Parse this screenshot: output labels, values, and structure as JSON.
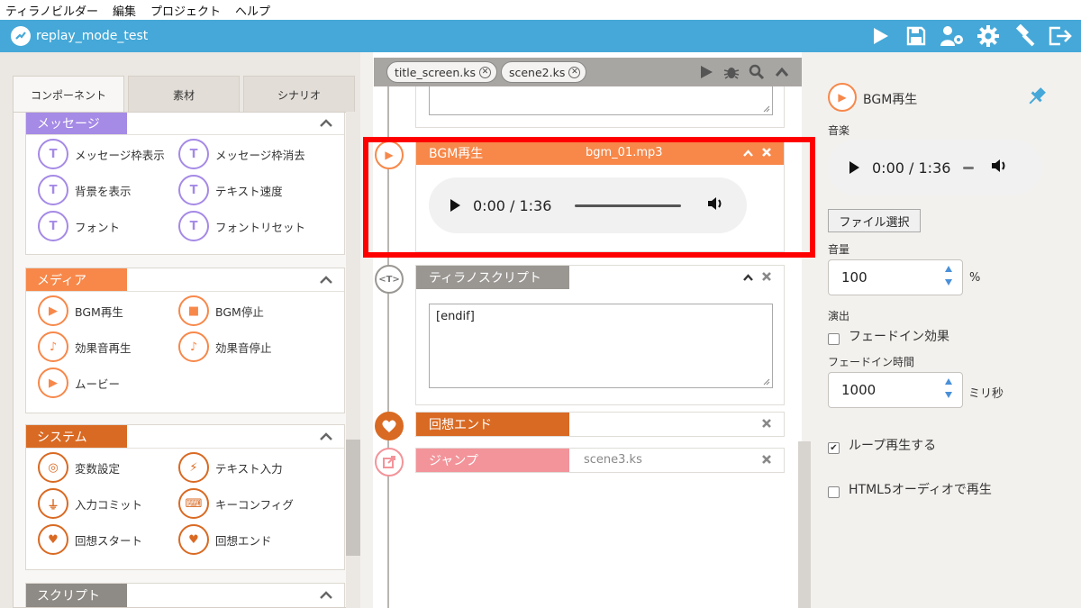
{
  "menu": [
    "ティラノビルダー",
    "編集",
    "プロジェクト",
    "ヘルプ"
  ],
  "app": {
    "title": "replay_mode_test",
    "accent": "#45a8d8",
    "toolbar_icons": [
      "play-icon",
      "save-icon",
      "users-gear-icon",
      "settings-gear-icon",
      "hammer-icon",
      "exit-icon"
    ]
  },
  "left_tabs": [
    "コンポーネント",
    "素材",
    "シナリオ"
  ],
  "categories": {
    "message": {
      "label": "メッセージ",
      "color": "#a58ae6",
      "items": [
        "メッセージ枠表示",
        "メッセージ枠消去",
        "背景を表示",
        "テキスト速度",
        "フォント",
        "フォントリセット"
      ]
    },
    "media": {
      "label": "メディア",
      "color": "#f7884a",
      "items": [
        "BGM再生",
        "BGM停止",
        "効果音再生",
        "効果音停止",
        "ムービー"
      ]
    },
    "system": {
      "label": "システム",
      "color": "#d96a23",
      "items": [
        "変数設定",
        "テキスト入力",
        "入力コミット",
        "キーコンフィグ",
        "回想スタート",
        "回想エンド"
      ]
    },
    "script": {
      "label": "スクリプト",
      "color": "#8e8a85"
    }
  },
  "file_tabs": [
    "title_screen.ks",
    "scene2.ks"
  ],
  "scenario": {
    "bgm_card": {
      "tag": "BGM再生",
      "value": "bgm_01.mp3",
      "audio_time": "0:00 / 1:36",
      "color": "#f7884a"
    },
    "tyrano_card": {
      "tag": "ティラノスクリプト",
      "code": "[endif]",
      "color": "#9a9793"
    },
    "recall_end_card": {
      "tag": "回想エンド",
      "color": "#d96a23"
    },
    "jump_card": {
      "tag": "ジャンプ",
      "value": "scene3.ks",
      "color": "#f3949a"
    }
  },
  "props": {
    "title": "BGM再生",
    "music_label": "音楽",
    "audio_time": "0:00 / 1:36",
    "file_button": "ファイル選択",
    "volume_label": "音量",
    "volume_value": "100",
    "volume_unit": "%",
    "effect_label": "演出",
    "fade_in_label": "フェードイン効果",
    "fade_in_checked": false,
    "fade_time_label": "フェードイン時間",
    "fade_time_value": "1000",
    "fade_time_unit": "ミリ秒",
    "loop_label": "ループ再生する",
    "loop_checked": true,
    "html5_label": "HTML5オーディオで再生",
    "html5_checked": false
  }
}
